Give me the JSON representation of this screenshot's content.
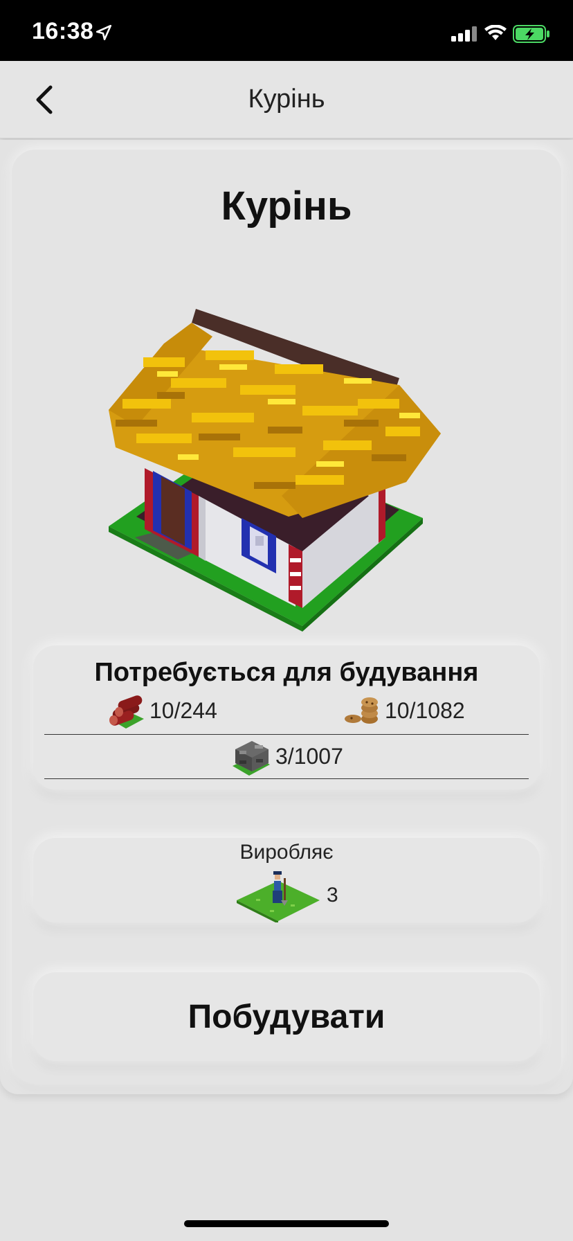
{
  "status_bar": {
    "time": "16:38"
  },
  "nav": {
    "title": "Курінь"
  },
  "building": {
    "title": "Курінь"
  },
  "requirements": {
    "title": "Потребується для будування",
    "resources": [
      {
        "icon": "logs-icon",
        "value": "10/244"
      },
      {
        "icon": "cookies-icon",
        "value": "10/1082"
      },
      {
        "icon": "stone-icon",
        "value": "3/1007"
      }
    ]
  },
  "produces": {
    "label": "Виробляє",
    "icon": "villager-icon",
    "value": "3"
  },
  "build_button": {
    "label": "Побудувати"
  },
  "colors": {
    "background": "#e3e3e3",
    "status_bar": "#000000",
    "battery": "#4cd964"
  }
}
